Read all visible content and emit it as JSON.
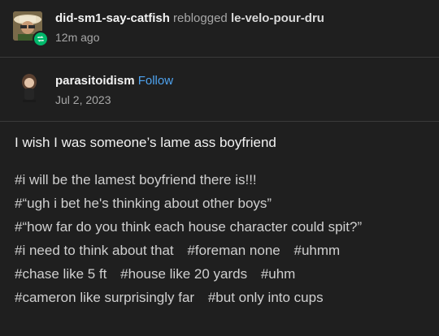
{
  "reblog": {
    "username": "did-sm1-say-catfish",
    "action": "reblogged",
    "source": "le-velo-pour-dru",
    "time": "12m ago",
    "badge_icon": "reblog-icon",
    "badge_color": "#00b86b"
  },
  "post": {
    "author": "parasitoidism",
    "follow_label": "Follow",
    "date": "Jul 2, 2023",
    "text": "I wish I was someone’s lame ass boyfriend"
  },
  "tags": [
    "#i will be the lamest boyfriend there is!!!",
    "#“ugh i bet he's thinking about other boys”",
    "#“how far do you think each house character could spit?”",
    "#i need to think about that",
    "#foreman none",
    "#uhmm",
    "#chase like 5 ft",
    "#house like 20 yards",
    "#uhm",
    "#cameron like surprisingly far",
    "#but only into cups"
  ],
  "colors": {
    "background": "#1f1f1f",
    "link": "#4ea3f0",
    "muted": "#a7a7a7"
  }
}
